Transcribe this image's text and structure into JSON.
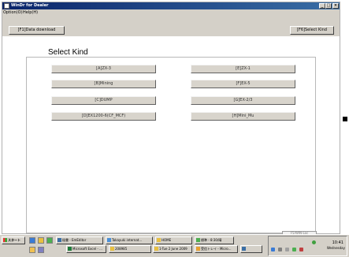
{
  "window": {
    "title": "WinDr for Dealer",
    "menu": [
      "Option(O)",
      "Help(H)"
    ],
    "controls": [
      "_",
      "□",
      "×"
    ]
  },
  "toolbar": {
    "data_download": "[F1]Data download",
    "select_kind": "[F6]Select Kind"
  },
  "main": {
    "heading": "Select Kind",
    "kinds": [
      "[A]ZX-3",
      "[E]ZX-1",
      "[B]Mining",
      "[F]EX-5",
      "[C]DUMP",
      "[G]EX-2/3",
      "[D]EX1200-6(CF_MCF)",
      "[H]Mini_Mu"
    ]
  },
  "status_field": "F5/WIN-Loc",
  "taskbar": {
    "start": "スタート",
    "quick_launch": [
      "ie-icon",
      "desktop-icon",
      "folder-icon",
      "messenger-icon",
      "media-icon"
    ],
    "tasks_row1": [
      "秘書 - EmEditor",
      "Takayuki internat...",
      "HOME",
      "標準 - 8:30/晴",
      "受信トレイ - Micro..."
    ],
    "tasks_row2": [
      "Microsoft Excel - ...",
      "208985",
      "1-Tue 2 June 2009",
      ""
    ],
    "clock": "10:41",
    "day": "Wednesday",
    "colors": {
      "titlebar_start": "#0a246a",
      "titlebar_end": "#3a6ea5",
      "face": "#d4d0c8"
    }
  }
}
